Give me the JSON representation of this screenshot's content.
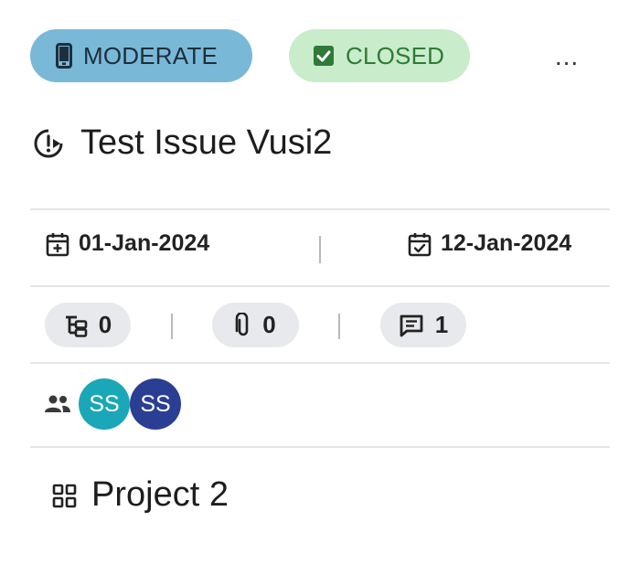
{
  "badges": {
    "priority": {
      "label": "MODERATE",
      "icon": "phone-icon",
      "bg": "#7ab8d8"
    },
    "status": {
      "label": "CLOSED",
      "icon": "check-box-icon",
      "bg": "#c9ecca"
    }
  },
  "menu": {
    "more_label": "..."
  },
  "issue": {
    "title": "Test Issue Vusi2",
    "icon": "issue-clock-icon"
  },
  "dates": {
    "start": "01-Jan-2024",
    "end": "12-Jan-2024",
    "separator": "|"
  },
  "counts": {
    "subtasks": "0",
    "attachments": "0",
    "comments": "1",
    "separator": "|"
  },
  "assignees": {
    "icon": "people-icon",
    "avatars": [
      {
        "initials": "SS",
        "color": "#1aa7b8"
      },
      {
        "initials": "SS",
        "color": "#2a3f93"
      }
    ]
  },
  "project": {
    "name": "Project 2",
    "icon": "grid-icon"
  }
}
